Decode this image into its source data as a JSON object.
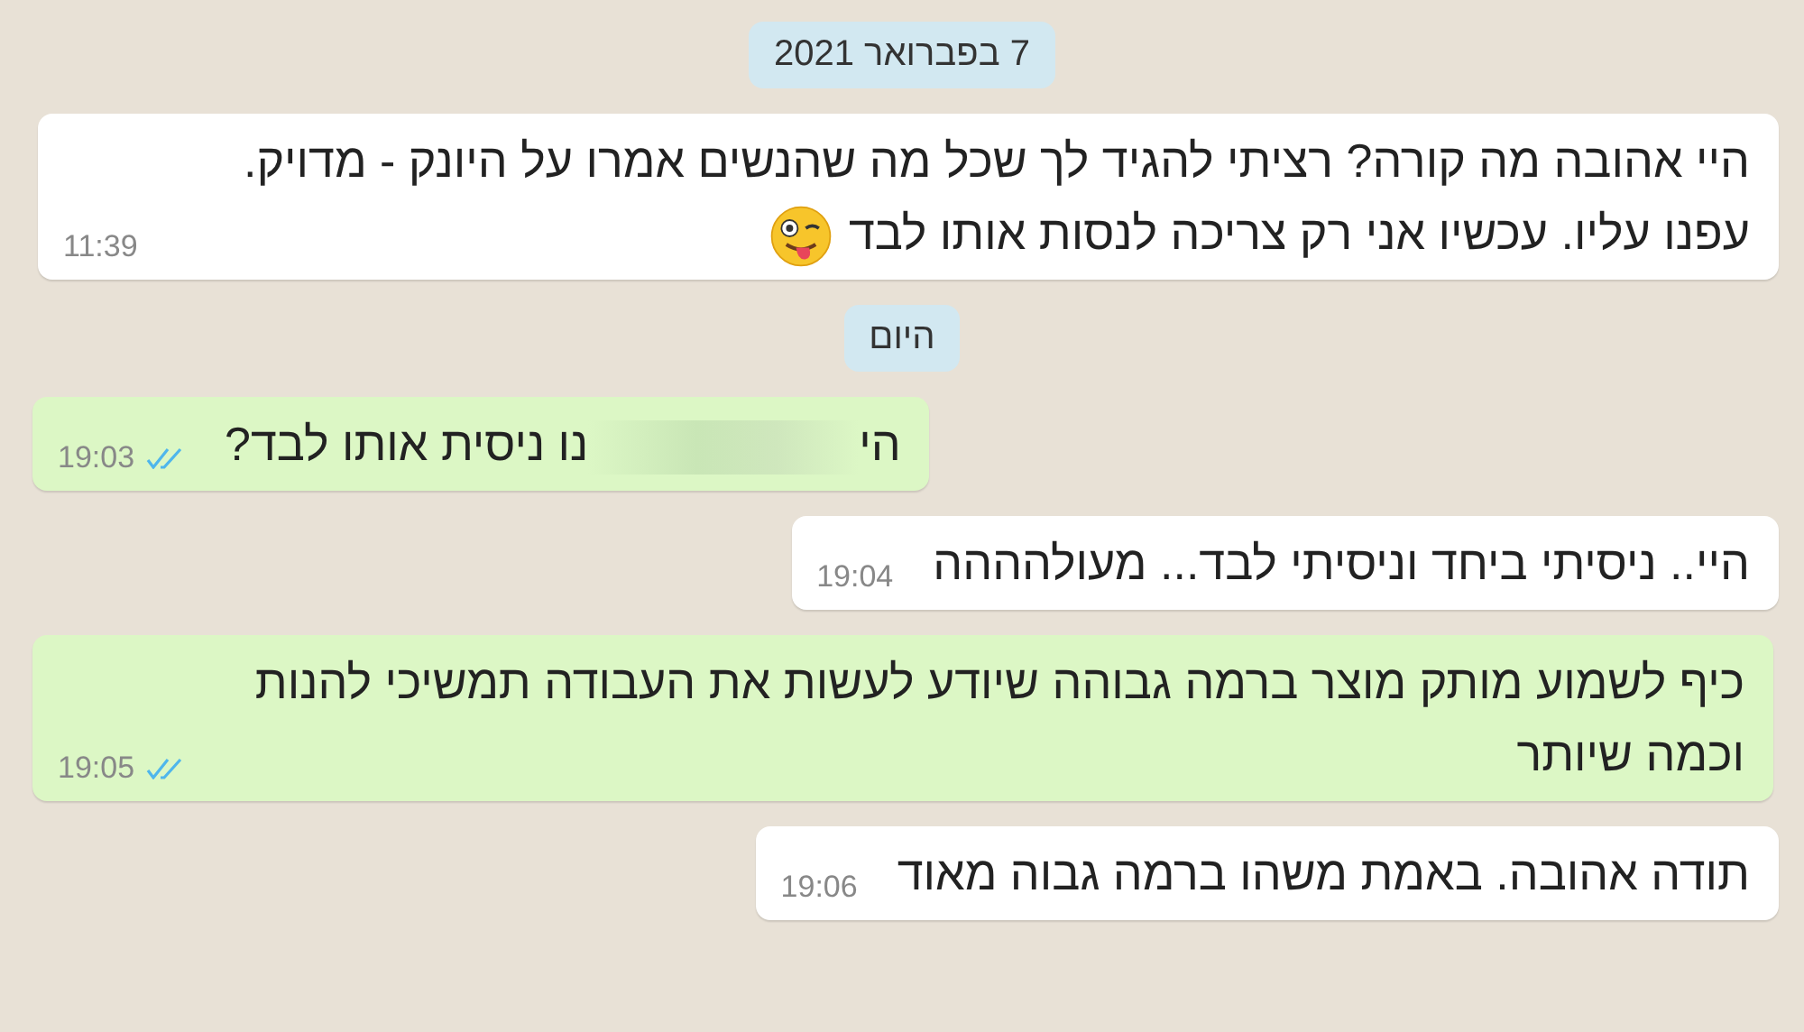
{
  "messages": [
    {
      "kind": "date",
      "text": "7 בפברואר 2021"
    },
    {
      "kind": "incoming",
      "text": "היי אהובה מה קורה? רציתי להגיד לך שכל מה שהנשים אמרו על היונק - מדויק. עפנו עליו. עכשיו אני רק צריכה לנסות אותו לבד",
      "has_emoji": true,
      "time": "11:39"
    },
    {
      "kind": "date",
      "text": "היום"
    },
    {
      "kind": "outgoing",
      "text": "הי",
      "text_after_blur": "נו ניסית אותו לבד?",
      "has_emoji": false,
      "time": "19:03",
      "read": true
    },
    {
      "kind": "incoming",
      "text": "היי.. ניסיתי ביחד וניסיתי לבד... מעולהההה",
      "has_emoji": false,
      "time": "19:04"
    },
    {
      "kind": "outgoing",
      "text": "כיף לשמוע מותק מוצר ברמה גבוהה שיודע לעשות את העבודה תמשיכי להנות וכמה שיותר",
      "has_emoji": false,
      "time": "19:05",
      "read": true
    },
    {
      "kind": "incoming",
      "text": "תודה אהובה. באמת משהו ברמה גבוה מאוד",
      "has_emoji": false,
      "time": "19:06"
    }
  ]
}
